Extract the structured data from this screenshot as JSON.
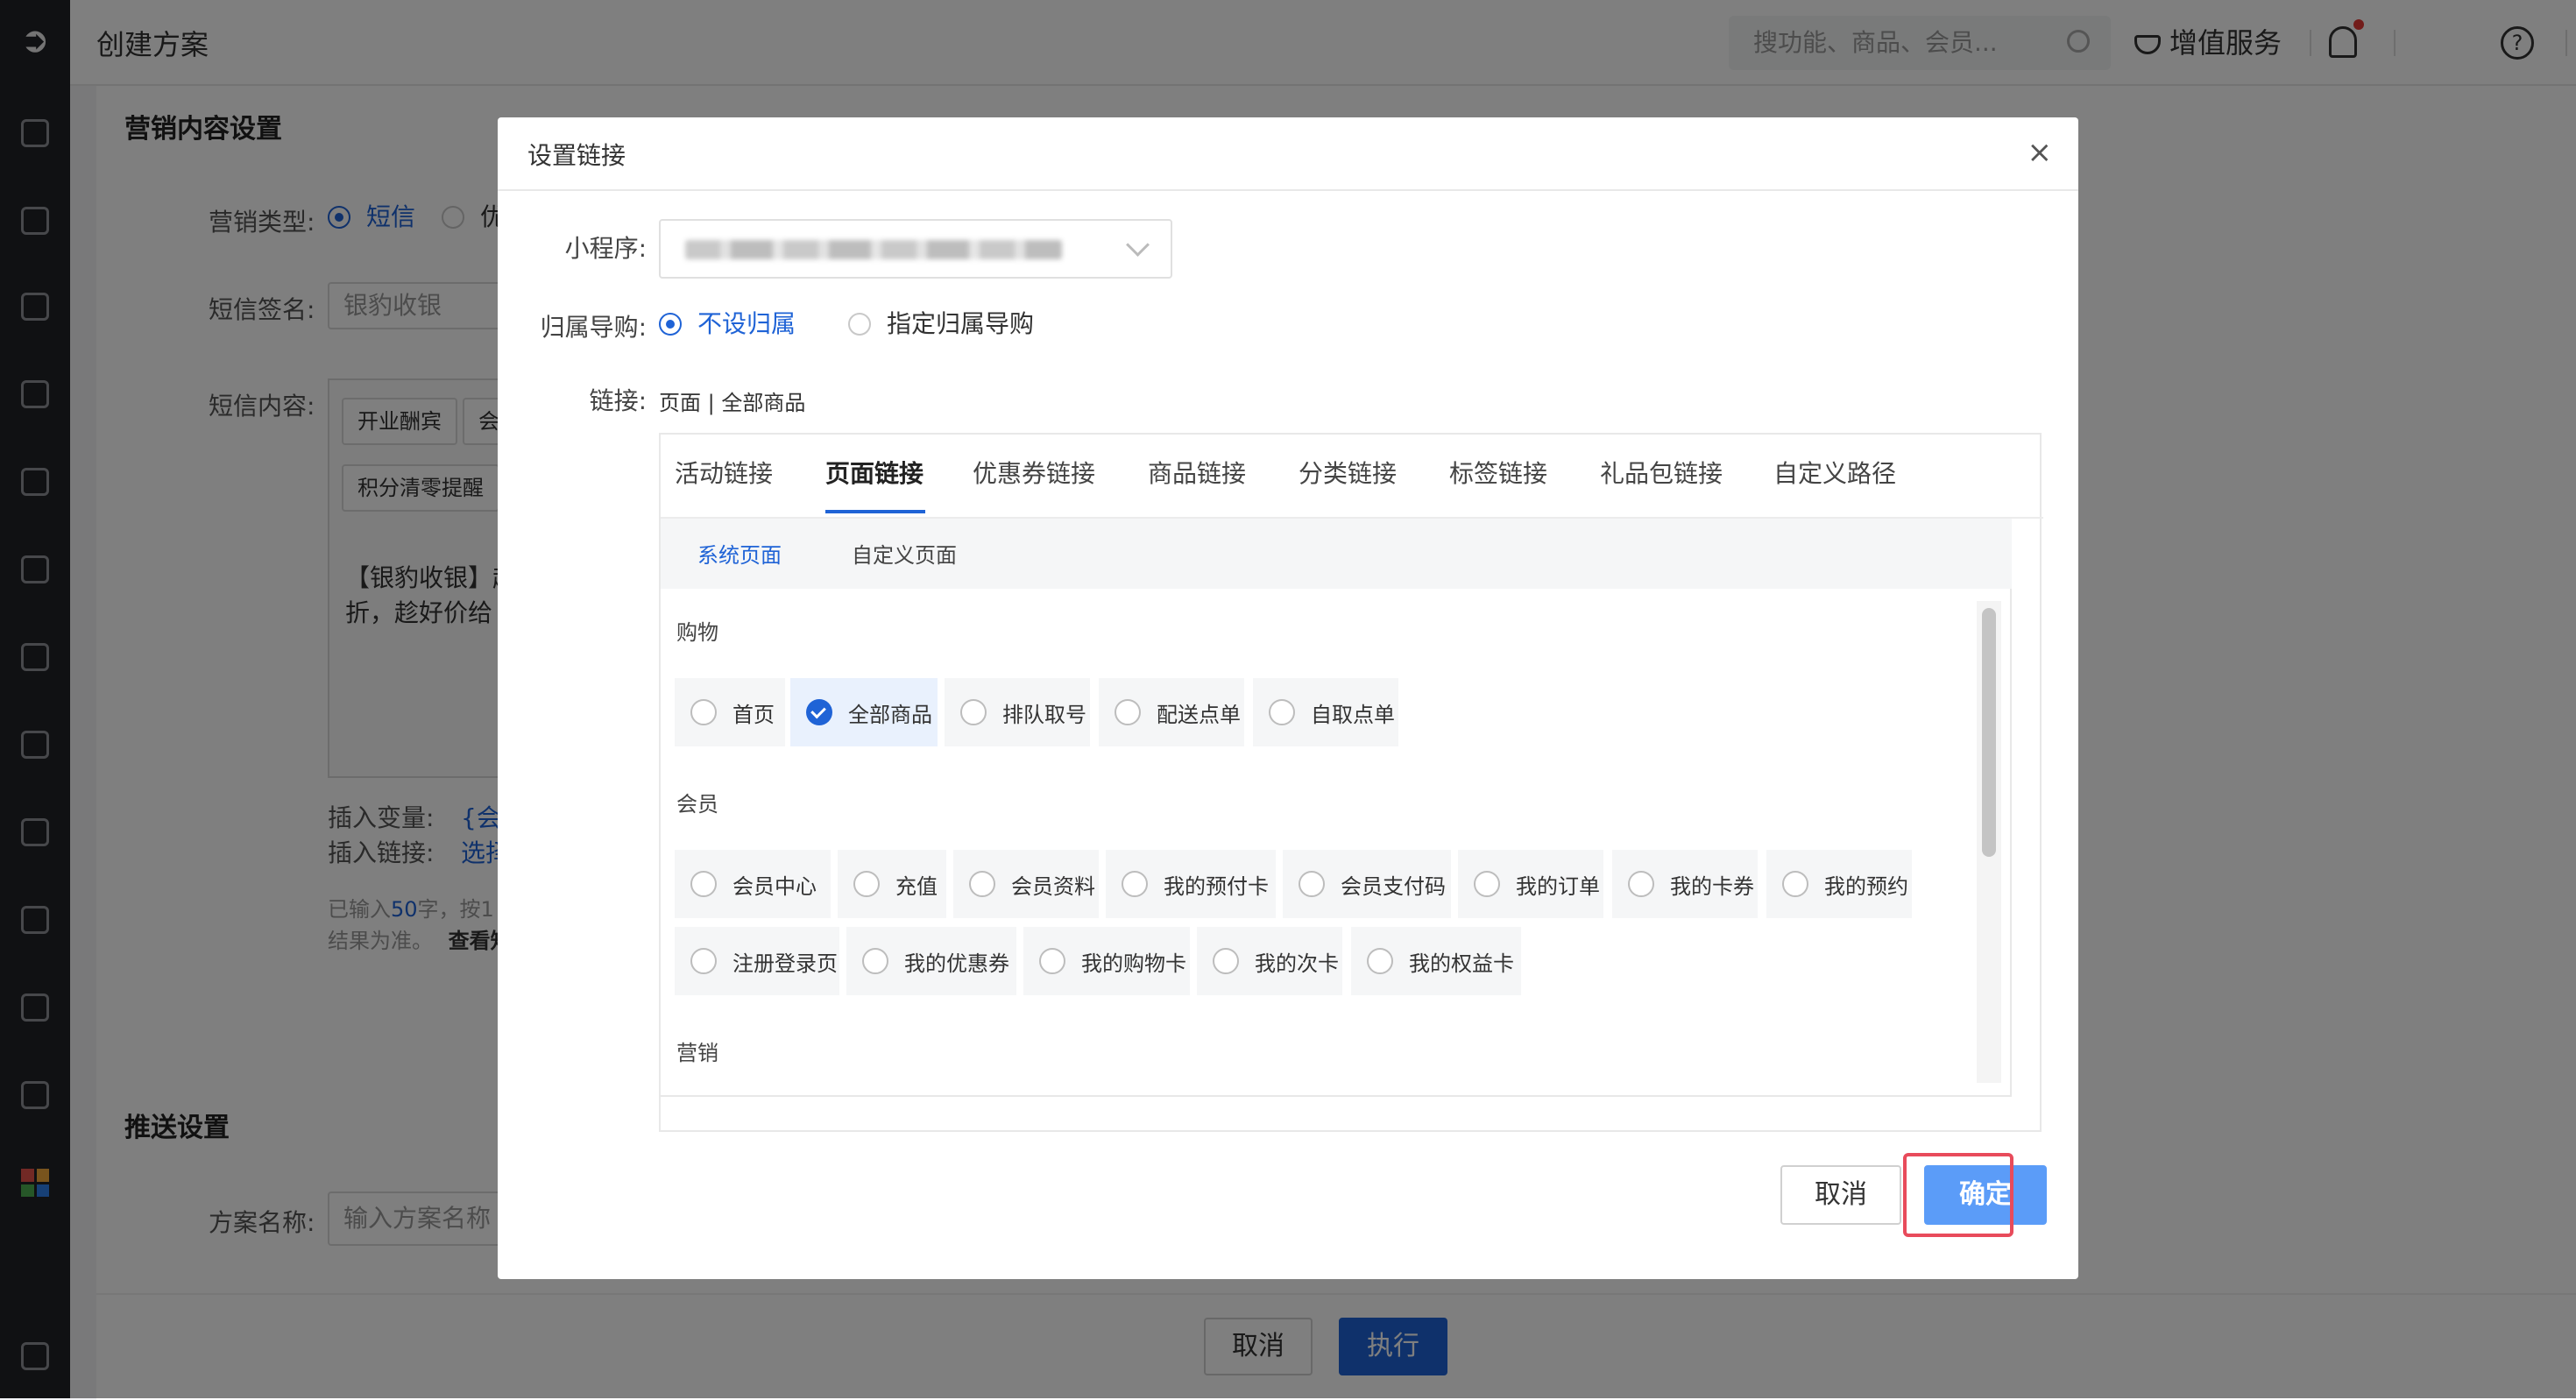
{
  "app": {
    "page_title": "创建方案",
    "search_placeholder": "搜功能、商品、会员...",
    "vip_label": "增值服务"
  },
  "background_form": {
    "section_marketing": "营销内容设置",
    "type_label": "营销类型:",
    "type_opt1": "短信",
    "type_opt2": "优",
    "signature_label": "短信签名:",
    "signature_value": "银豹收银",
    "content_label": "短信内容:",
    "chip1": "开业酬宾",
    "chip2": "会",
    "chip3": "积分清零提醒",
    "content_line1": "【银豹收银】超",
    "content_line2": "折，趁好价给",
    "insert_var_label": "插入变量:",
    "insert_var_value": "{会员",
    "insert_link_label": "插入链接:",
    "insert_link_value": "选择",
    "count_line1_prefix": "已输入",
    "count_line1_num": "50",
    "count_line1_suffix": "字，按1",
    "count_line2": "结果为准。",
    "count_link": "查看知",
    "section_push": "推送设置",
    "plan_name_label": "方案名称:",
    "plan_name_placeholder": "输入方案名称",
    "cancel_label": "取消",
    "execute_label": "执行"
  },
  "modal": {
    "title": "设置链接",
    "close_glyph": "×",
    "mini_program_label": "小程序:",
    "guide_label": "归属导购:",
    "guide_opt1": "不设归属",
    "guide_opt2": "指定归属导购",
    "link_label": "链接:",
    "link_value": "页面 | 全部商品",
    "tabs": [
      "活动链接",
      "页面链接",
      "优惠券链接",
      "商品链接",
      "分类链接",
      "标签链接",
      "礼品包链接",
      "自定义路径"
    ],
    "active_tab": "页面链接",
    "sub_tabs": [
      "系统页面",
      "自定义页面"
    ],
    "active_sub_tab": "系统页面",
    "groups": {
      "shopping": {
        "title": "购物",
        "options": [
          "首页",
          "全部商品",
          "排队取号",
          "配送点单",
          "自取点单"
        ]
      },
      "member": {
        "title": "会员",
        "options": [
          "会员中心",
          "充值",
          "会员资料",
          "我的预付卡",
          "会员支付码",
          "我的订单",
          "我的卡券",
          "我的预约",
          "注册登录页",
          "我的优惠券",
          "我的购物卡",
          "我的次卡",
          "我的权益卡"
        ]
      },
      "marketing": {
        "title": "营销"
      }
    },
    "selected_option": "全部商品",
    "cancel_label": "取消",
    "confirm_label": "确定"
  },
  "colors": {
    "accent": "#1f63d6",
    "highlight_box": "#e84b5b",
    "sidebar": "#202226"
  }
}
